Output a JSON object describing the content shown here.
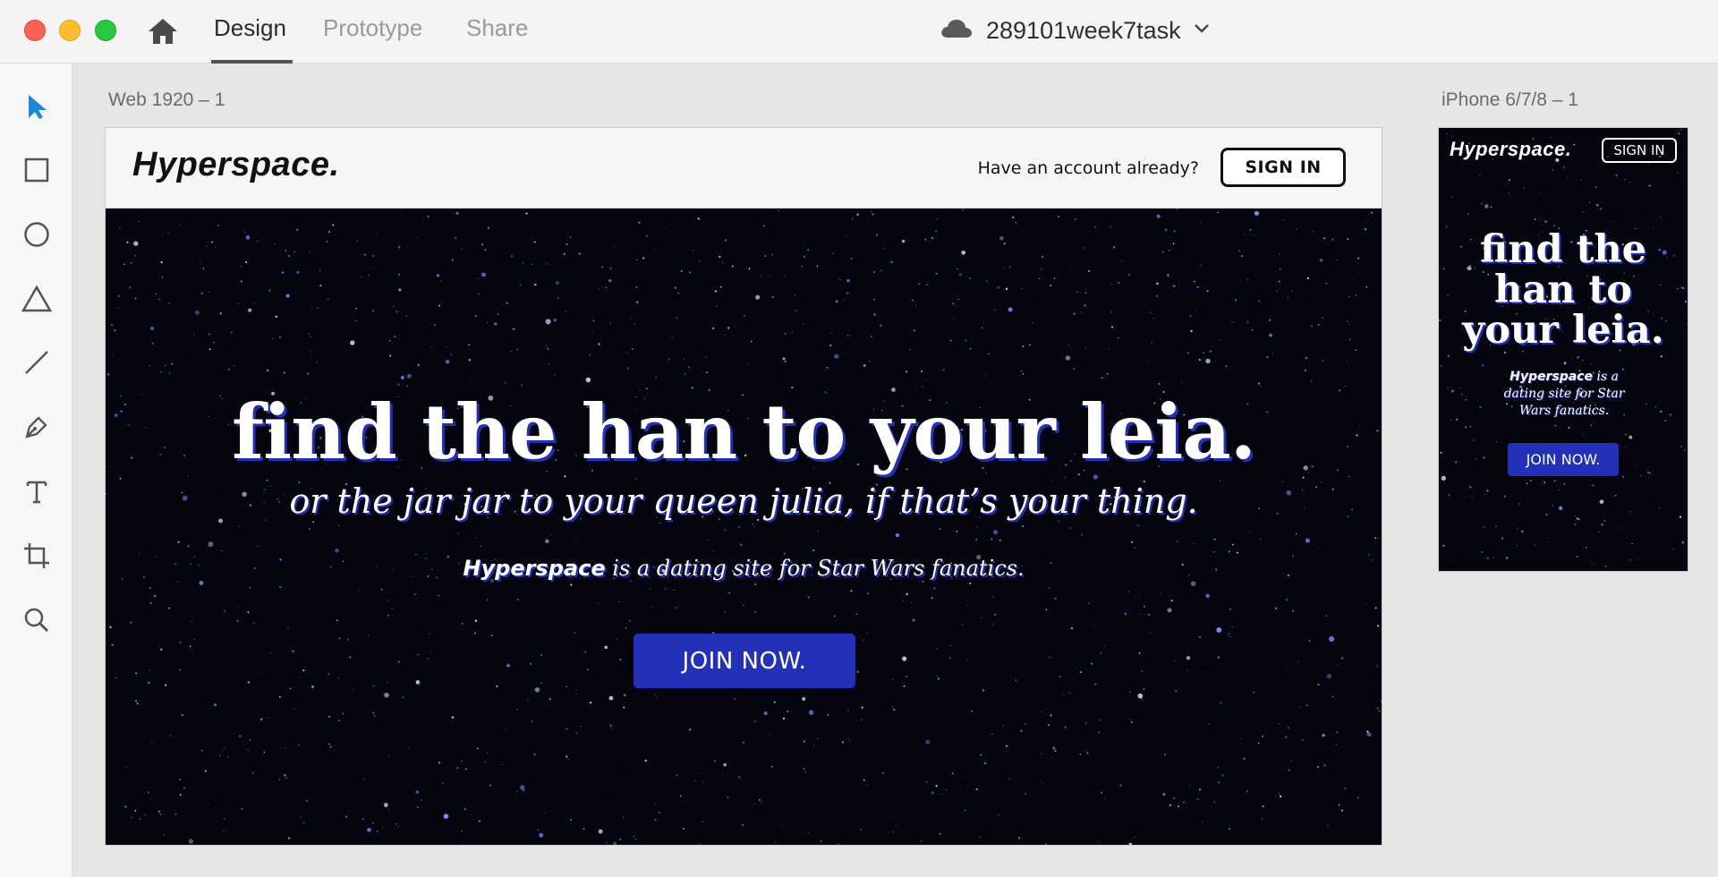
{
  "titlebar": {
    "tabs": [
      {
        "label": "Design",
        "active": true
      },
      {
        "label": "Prototype",
        "active": false
      },
      {
        "label": "Share",
        "active": false
      }
    ],
    "document_name": "289101week7task"
  },
  "toolbar": {
    "tools": [
      "select-icon",
      "rectangle-icon",
      "ellipse-icon",
      "triangle-icon",
      "line-icon",
      "pen-icon",
      "text-icon",
      "artboard-icon",
      "zoom-icon"
    ]
  },
  "artboards": {
    "web": {
      "label": "Web 1920 – 1",
      "logo": "Hyperspace.",
      "account_prompt": "Have an account already?",
      "signin_label": "SIGN IN",
      "headline": "find the han to your leia.",
      "subheadline": "or the jar jar to your queen julia, if that’s your thing.",
      "tagline_brand": "Hyperspace",
      "tagline_rest": " is a dating site for Star Wars fanatics.",
      "cta_label": "JOIN NOW."
    },
    "phone": {
      "label": "iPhone 6/7/8 – 1",
      "logo": "Hyperspace.",
      "signin_label": "SIGN IN",
      "headline_lines": [
        "find the",
        "han to",
        "your leia."
      ],
      "tagline_brand": "Hyperspace",
      "tagline_rest": " is a dating site for Star Wars fanatics.",
      "cta_label": "JOIN NOW."
    }
  },
  "colors": {
    "accent_tool": "#1a8ad8",
    "cta_blue": "#2330b8",
    "space_bg": "#050510"
  }
}
